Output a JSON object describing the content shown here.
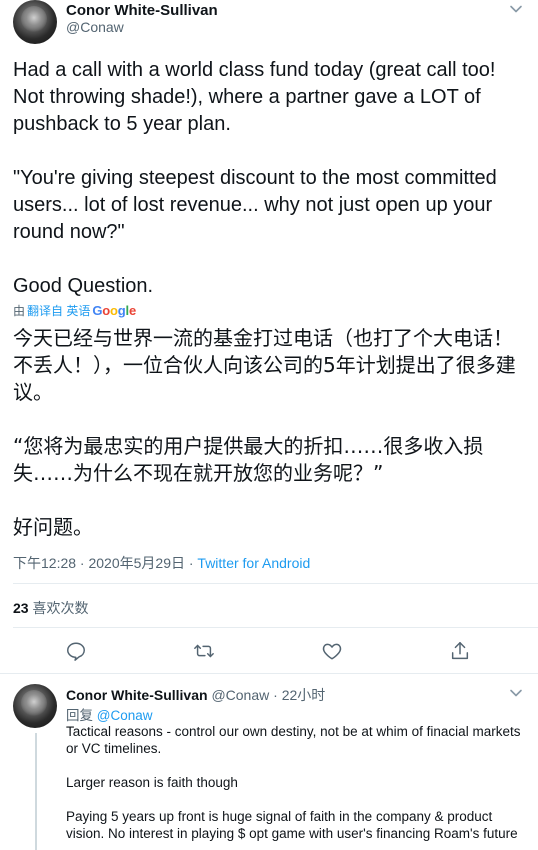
{
  "tweet": {
    "author_name": "Conor White-Sullivan",
    "author_handle": "@Conaw",
    "paragraphs": [
      "Had a call with a world class fund today (great call too! Not throwing shade!), where a partner gave a LOT of pushback to 5 year plan.",
      "\"You're giving steepest discount to the most committed users... lot of lost revenue... why not just open up your round now?\"",
      "Good Question."
    ],
    "translate_prefix": "由",
    "translate_link": "翻译自 英语",
    "translate_brand": "Google",
    "translation_paragraphs": [
      "今天已经与世界一流的基金打过电话（也打了个大电话！不丢人！），一位合伙人向该公司的5年计划提出了很多建议。",
      "“您将为最忠实的用户提供最大的折扣……很多收入损失……为什么不现在就开放您的业务呢？”",
      "好问题。"
    ],
    "timestamp": "下午12:28 · 2020年5月29日 · ",
    "client": "Twitter for Android",
    "like_count": "23",
    "like_label": " 喜欢次数"
  },
  "reply": {
    "author_name": "Conor White-Sullivan",
    "author_handle": "@Conaw",
    "time": "· 22小时",
    "reply_to_prefix": "回复 ",
    "reply_to_handle": "@Conaw",
    "paragraphs": [
      "Tactical reasons - control our own destiny, not be at whim of finacial markets or VC timelines.",
      "Larger reason is faith though",
      "Paying 5 years up front is huge signal of faith in the company & product vision. No interest in playing $ opt game with user's financing Roam's future"
    ]
  },
  "colors": {
    "accent": "#1d9bf0",
    "muted": "#536471",
    "divider": "#e6ecf0"
  },
  "icons": [
    "chevron-down-icon",
    "reply-icon",
    "retweet-icon",
    "like-icon",
    "share-icon"
  ]
}
